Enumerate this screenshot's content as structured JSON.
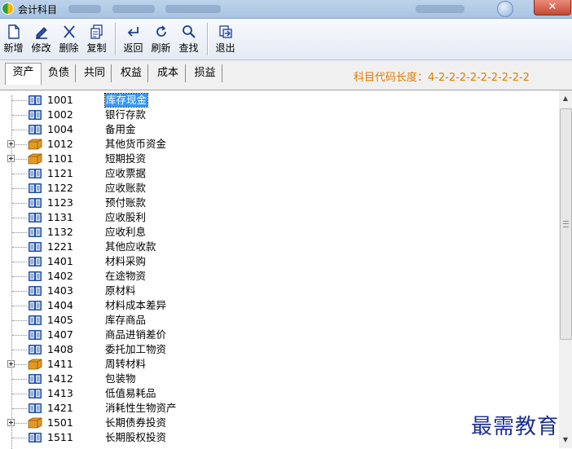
{
  "window": {
    "title": "会计科目",
    "close_symbol": "✕"
  },
  "toolbar": {
    "buttons": [
      {
        "label": "新增",
        "icon": "new-document-icon"
      },
      {
        "label": "修改",
        "icon": "edit-pencil-icon"
      },
      {
        "label": "删除",
        "icon": "delete-x-icon"
      },
      {
        "label": "复制",
        "icon": "copy-icon"
      },
      {
        "label": "返回",
        "icon": "return-arrow-icon"
      },
      {
        "label": "刷新",
        "icon": "refresh-icon"
      },
      {
        "label": "查找",
        "icon": "search-icon"
      },
      {
        "label": "退出",
        "icon": "exit-icon"
      }
    ]
  },
  "tabs": [
    "资产",
    "负债",
    "共同",
    "权益",
    "成本",
    "损益"
  ],
  "active_tab": "资产",
  "code_length_label": "科目代码长度：4-2-2-2-2-2-2-2-2-2",
  "accounts": [
    {
      "code": "1001",
      "name": "库存现金",
      "has_children": false,
      "selected": true
    },
    {
      "code": "1002",
      "name": "银行存款",
      "has_children": false
    },
    {
      "code": "1004",
      "name": "备用金",
      "has_children": false
    },
    {
      "code": "1012",
      "name": "其他货币资金",
      "has_children": true
    },
    {
      "code": "1101",
      "name": "短期投资",
      "has_children": true
    },
    {
      "code": "1121",
      "name": "应收票据",
      "has_children": false
    },
    {
      "code": "1122",
      "name": "应收账款",
      "has_children": false
    },
    {
      "code": "1123",
      "name": "预付账款",
      "has_children": false
    },
    {
      "code": "1131",
      "name": "应收股利",
      "has_children": false
    },
    {
      "code": "1132",
      "name": "应收利息",
      "has_children": false
    },
    {
      "code": "1221",
      "name": "其他应收款",
      "has_children": false
    },
    {
      "code": "1401",
      "name": "材料采购",
      "has_children": false
    },
    {
      "code": "1402",
      "name": "在途物资",
      "has_children": false
    },
    {
      "code": "1403",
      "name": "原材料",
      "has_children": false
    },
    {
      "code": "1404",
      "name": "材料成本差异",
      "has_children": false
    },
    {
      "code": "1405",
      "name": "库存商品",
      "has_children": false
    },
    {
      "code": "1407",
      "name": "商品进销差价",
      "has_children": false
    },
    {
      "code": "1408",
      "name": "委托加工物资",
      "has_children": false
    },
    {
      "code": "1411",
      "name": "周转材料",
      "has_children": true
    },
    {
      "code": "1412",
      "name": "包装物",
      "has_children": false
    },
    {
      "code": "1413",
      "name": "低值易耗品",
      "has_children": false
    },
    {
      "code": "1421",
      "name": "消耗性生物资产",
      "has_children": false
    },
    {
      "code": "1501",
      "name": "长期债券投资",
      "has_children": true
    },
    {
      "code": "1511",
      "name": "长期股权投资",
      "has_children": false
    }
  ],
  "watermark": "最需教育",
  "colors": {
    "selection": "#3297fd",
    "code_length_text": "#e07b00",
    "book_icon": "#1f4fa8",
    "folder_icon": "#e39a22",
    "watermark": "#1d2f8f"
  }
}
